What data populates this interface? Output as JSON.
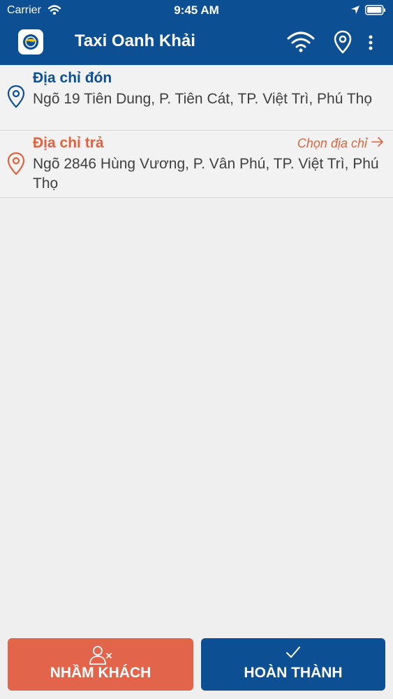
{
  "status_bar": {
    "carrier": "Carrier",
    "time": "9:45 AM",
    "icons": [
      "wifi-icon",
      "location-arrow-icon",
      "battery-icon"
    ]
  },
  "app_bar": {
    "title": "Taxi Oanh Khải",
    "icons": [
      "app-logo",
      "wifi-icon",
      "location-pin-icon",
      "more-vertical-icon"
    ]
  },
  "pickup": {
    "label": "Địa chỉ đón",
    "address": "Ngõ 19 Tiên Dung, P. Tiên Cát, TP. Việt Trì, Phú Thọ",
    "color": "#0d4f93"
  },
  "dropoff": {
    "label": "Địa chỉ trả",
    "address": "Ngõ 2846 Hùng Vương, P. Vân Phú, TP. Việt Trì, Phú Thọ",
    "action": "Chọn địa chỉ",
    "color": "#e0623f"
  },
  "buttons": {
    "wrong_customer": "NHẦM KHÁCH",
    "complete": "HOÀN THÀNH"
  },
  "colors": {
    "primary": "#0d4f93",
    "accent": "#e2644a",
    "background": "#efefef"
  }
}
